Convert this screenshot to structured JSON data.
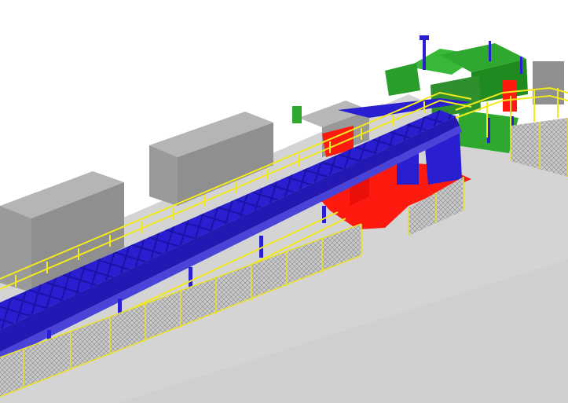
{
  "scene": {
    "colors": {
      "background": "#ffffff",
      "ground": "#d4d4d4",
      "building": "#9a9a9a",
      "building_roof": "#b5b5b5",
      "conveyor": "#2a1fd0",
      "walkway_rail": "#f2ea1c",
      "crusher_station": "#ff1a10",
      "control_module": "#2fa82f",
      "fence_panel": "#b8b8b8",
      "fence_post": "#e8e030"
    },
    "components": [
      "conveyor-gallery",
      "walkway-handrail",
      "crusher-station",
      "control-house",
      "security-fence",
      "grey-building-left",
      "grey-building-middle",
      "grey-building-right"
    ]
  }
}
